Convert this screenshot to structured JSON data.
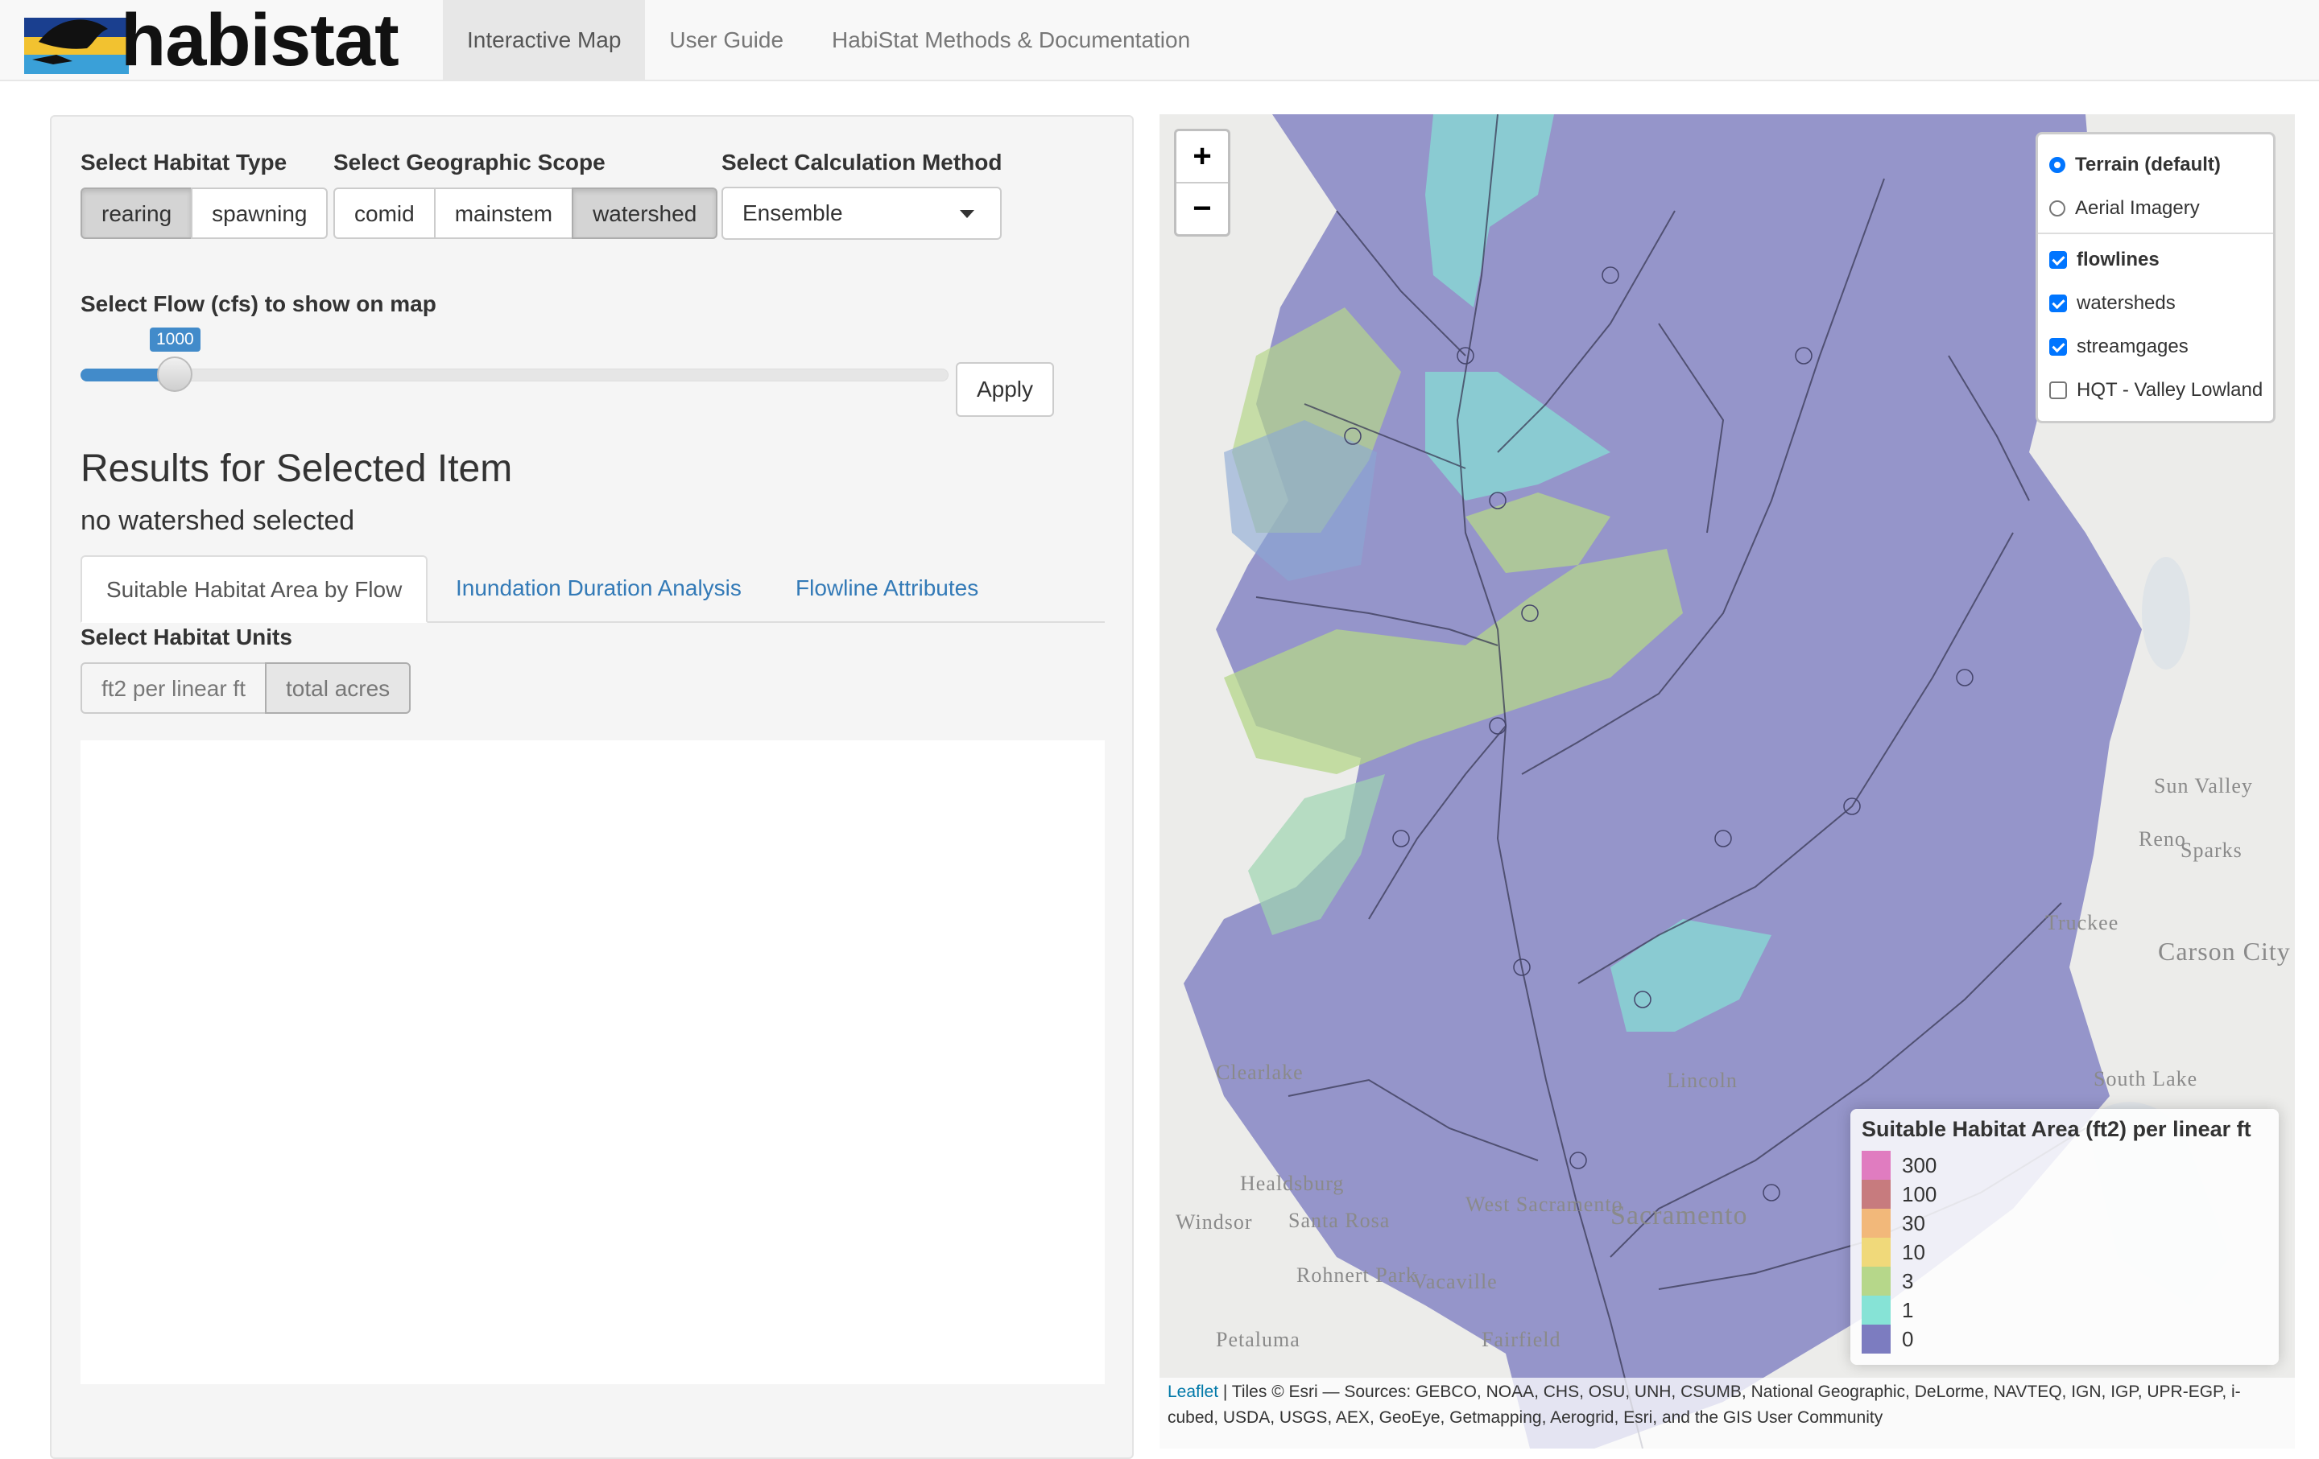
{
  "brand": {
    "name_black": "habi",
    "name_accent": "stat"
  },
  "nav": {
    "tabs": [
      "Interactive Map",
      "User Guide",
      "HabiStat Methods & Documentation"
    ],
    "active": 0
  },
  "controls": {
    "habitat_type": {
      "label": "Select Habitat Type",
      "options": [
        "rearing",
        "spawning"
      ],
      "selected": "rearing"
    },
    "geo_scope": {
      "label": "Select Geographic Scope",
      "options": [
        "comid",
        "mainstem",
        "watershed"
      ],
      "selected": "watershed"
    },
    "calc_method": {
      "label": "Select Calculation Method",
      "value": "Ensemble"
    },
    "flow": {
      "label": "Select Flow (cfs) to show on map",
      "value": "1000",
      "fraction": 0.11
    },
    "apply_label": "Apply"
  },
  "results": {
    "title": "Results for Selected Item",
    "subtitle": "no watershed selected",
    "tabs": [
      "Suitable Habitat Area by Flow",
      "Inundation Duration Analysis",
      "Flowline Attributes"
    ],
    "units_label": "Select Habitat Units",
    "units": [
      "ft2 per linear ft",
      "total acres"
    ],
    "units_selected": "total acres"
  },
  "map": {
    "zoom_in": "+",
    "zoom_out": "−",
    "basemaps": [
      {
        "label": "Terrain (default)",
        "selected": true
      },
      {
        "label": "Aerial Imagery",
        "selected": false
      }
    ],
    "overlays": [
      {
        "label": "flowlines",
        "checked": true
      },
      {
        "label": "watersheds",
        "checked": true
      },
      {
        "label": "streamgages",
        "checked": true
      },
      {
        "label": "HQT - Valley Lowland",
        "checked": false
      }
    ],
    "legend": {
      "title": "Suitable Habitat Area (ft2) per linear ft",
      "items": [
        {
          "label": "300",
          "color": "#e07cc0"
        },
        {
          "label": "100",
          "color": "#c77b7e"
        },
        {
          "label": "30",
          "color": "#f2b87a"
        },
        {
          "label": "10",
          "color": "#f0d97a"
        },
        {
          "label": "3",
          "color": "#b6d78a"
        },
        {
          "label": "1",
          "color": "#86e3d6"
        },
        {
          "label": "0",
          "color": "#7c7cc0"
        }
      ]
    },
    "attribution_link": "Leaflet",
    "attribution_text": " | Tiles © Esri — Sources: GEBCO, NOAA, CHS, OSU, UNH, CSUMB, National Geographic, DeLorme, NAVTEQ, IGN, IGP, UPR-EGP, i-cubed, USDA, USGS, AEX, GeoEye, Getmapping, Aerogrid, Esri, and the GIS User Community",
    "place_labels": [
      "Sun Valley",
      "Reno",
      "Sparks",
      "Truckee",
      "Carson City",
      "Santa Rosa",
      "Rohnert Park",
      "Healdsburg",
      "Windsor",
      "Petaluma",
      "Vacaville",
      "West Sacramento",
      "Sacramento",
      "Fairfield",
      "Clearlake",
      "Lincoln",
      "South Lake"
    ]
  }
}
